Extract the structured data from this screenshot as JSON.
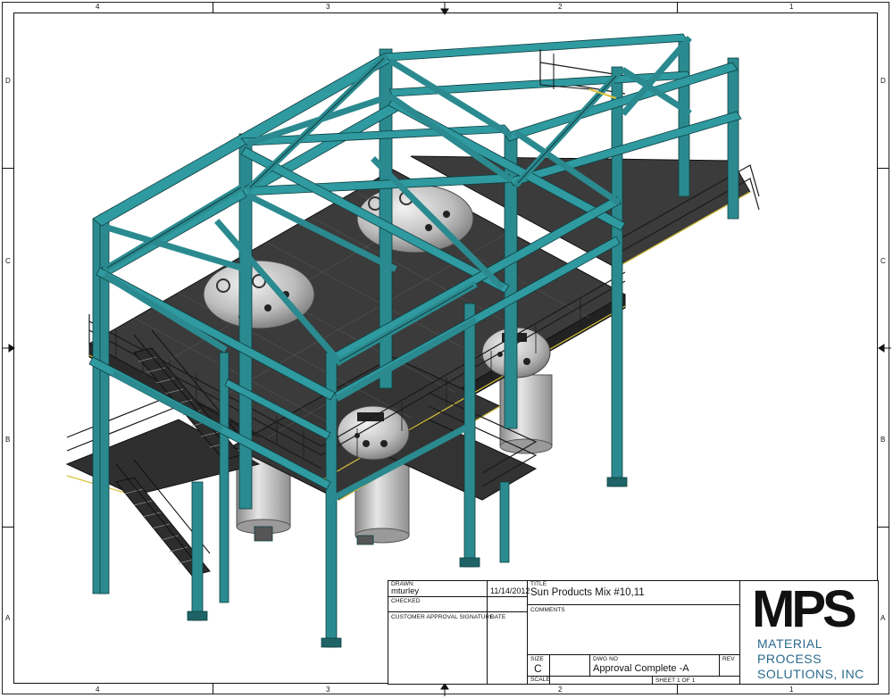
{
  "zones": {
    "columns": [
      "4",
      "3",
      "2",
      "1"
    ],
    "rows": [
      "D",
      "C",
      "B",
      "A"
    ]
  },
  "title_block": {
    "drawn_label": "DRAWN",
    "drawn_by": "mturley",
    "drawn_date": "11/14/2012",
    "checked_label": "CHECKED",
    "title_label": "TITLE",
    "title": "Sun Products Mix #10,11",
    "comments_label": "COMMENTS",
    "approval_label": "CUSTOMER APPROVAL SIGNATURE",
    "date_label": "DATE",
    "size_label": "SIZE",
    "size": "C",
    "dwg_label": "DWG NO",
    "dwg_no": "Approval Complete -A",
    "rev_label": "REV",
    "scale_label": "SCALE",
    "sheet": "SHEET 1  OF 1"
  },
  "logo": {
    "mark": "MPS",
    "line1": "MATERIAL",
    "line2": "PROCESS",
    "line3": "SOLUTIONS, INC"
  },
  "colors": {
    "steel": "#2a8a8f",
    "steel_dark": "#1f6366",
    "deck": "#3a3a3a",
    "tank": "#c9c9c9",
    "rail_stripe": "#d9c23a",
    "logo_sub": "#2b6a8c"
  }
}
